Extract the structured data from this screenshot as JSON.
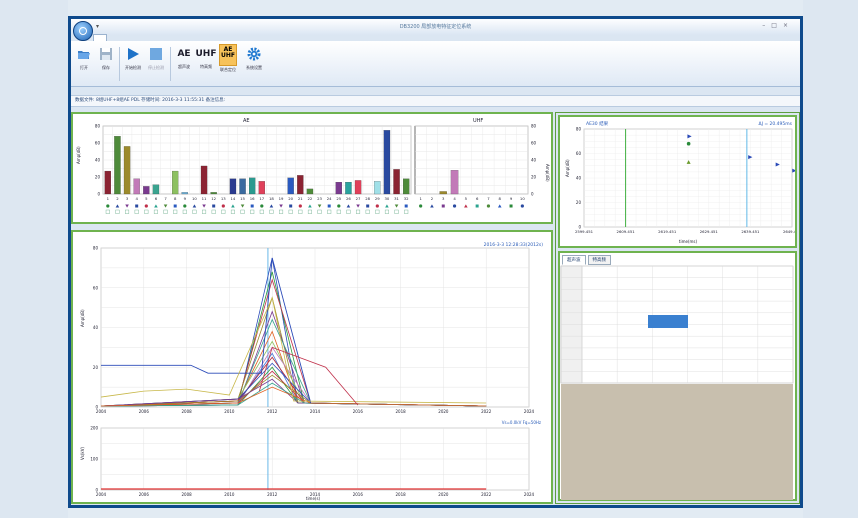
{
  "window": {
    "title": "DB3200 局部放电特征定位系统",
    "quick_access": "▾"
  },
  "ribbon": {
    "buttons": [
      {
        "name": "open",
        "label": "打开"
      },
      {
        "name": "save",
        "label": "保存"
      },
      {
        "name": "start",
        "label": "开始检测"
      },
      {
        "name": "stop",
        "label": "停止检测"
      },
      {
        "name": "ae",
        "label": "超声波",
        "glyph": "AE"
      },
      {
        "name": "uhf",
        "label": "特高频",
        "glyph": "UHF"
      },
      {
        "name": "aeuhf",
        "label": "联合定位",
        "glyph1": "AE",
        "glyph2": "UHF"
      },
      {
        "name": "settings",
        "label": "系统设置"
      }
    ]
  },
  "status_text": "数据文件: 8组UHF+8组AE PDL   存储时间: 2016-3-3 11:55:31   备注信息:",
  "top_chart": {
    "ae_title": "AE",
    "uhf_title": "UHF",
    "left_ylabel": "Amp(dB)",
    "right_ylabel": "Amp(dB)",
    "ae_yticks": [
      "80",
      "60",
      "40",
      "20",
      "0"
    ],
    "uhf_yticks": [
      "80",
      "60",
      "40",
      "20",
      "0"
    ],
    "ae_categories": [
      "1",
      "2",
      "3",
      "4",
      "5",
      "6",
      "7",
      "8",
      "9",
      "10",
      "11",
      "12",
      "13",
      "14",
      "15",
      "16",
      "17",
      "18",
      "19",
      "20",
      "21",
      "22",
      "23",
      "24",
      "25",
      "26",
      "27",
      "28",
      "29",
      "30",
      "31",
      "32"
    ],
    "ae_values": [
      27,
      68,
      56,
      18,
      9,
      11,
      0,
      27,
      2,
      0,
      33,
      2,
      0,
      18,
      18,
      19,
      15,
      0,
      0,
      19,
      22,
      6,
      0,
      0,
      14,
      14,
      16,
      0,
      15,
      75,
      29,
      18
    ],
    "ae_colors": [
      "#8b2332",
      "#4e8b3a",
      "#9c8a2c",
      "#c27ab8",
      "#7a3a8f",
      "#3aa38f",
      "#c25a6a",
      "#8cc060",
      "#6ab0d8",
      "#6a9ac0",
      "#8b2332",
      "#4e8b3a",
      "#9c8a2c",
      "#2a3a8f",
      "#3a6a9f",
      "#2a9a8f",
      "#e0405a",
      "#8cc060",
      "#a0c8e8",
      "#2a5ac0",
      "#8b2332",
      "#4e8b3a",
      "#9c8a2c",
      "#c27ab8",
      "#7a3a8f",
      "#2aa39f",
      "#e0405a",
      "#8cc060",
      "#a0e0e8",
      "#2a4aa0",
      "#8b2332",
      "#4e8b3a"
    ],
    "uhf_categories": [
      "1",
      "2",
      "3",
      "4",
      "5",
      "6",
      "7",
      "8",
      "9",
      "10"
    ],
    "uhf_values": [
      0,
      0,
      3,
      28,
      0,
      0,
      0,
      0,
      0,
      0
    ],
    "uhf_colors": [
      "#8b2332",
      "#4e8b3a",
      "#9c8a2c",
      "#c27ab8",
      "#7a3a8f",
      "#3aa38f",
      "#c25a6a",
      "#8cc060",
      "#6ab0d8",
      "#2a5ac0"
    ]
  },
  "trend_chart": {
    "timestamp": "2016-3-3 12:28:33(2012s)",
    "ylabel": "Amp(dB)",
    "yticks": [
      "80",
      "60",
      "40",
      "20",
      "0"
    ],
    "xticks": [
      "2004",
      "2006",
      "2008",
      "2010",
      "2012",
      "2014",
      "2016",
      "2018",
      "2020",
      "2022",
      "2024"
    ]
  },
  "voltage_chart": {
    "legend": "Vs=0.0kV Fq=50Hz",
    "ylabel": "Vs(kV)",
    "yticks": [
      "200",
      "100",
      "0"
    ],
    "xticks": [
      "2004",
      "2006",
      "2008",
      "2010",
      "2012",
      "2014",
      "2016",
      "2018",
      "2020",
      "2022",
      "2024"
    ],
    "xlabel": "time(s)"
  },
  "scatter_chart": {
    "title_left": "AE30  结果",
    "title_right": "ΔJ = 20.495ms",
    "ylabel": "Amp(dB)",
    "yticks": [
      "80",
      "60",
      "40",
      "20",
      "0"
    ],
    "xticks": [
      "2599.451",
      "2609.451",
      "2619.451",
      "2629.451",
      "2639.451",
      "2649.451"
    ],
    "xlabel": "time(ms)"
  },
  "bottom_right": {
    "tabs": [
      "超声波",
      "特高频"
    ]
  }
}
